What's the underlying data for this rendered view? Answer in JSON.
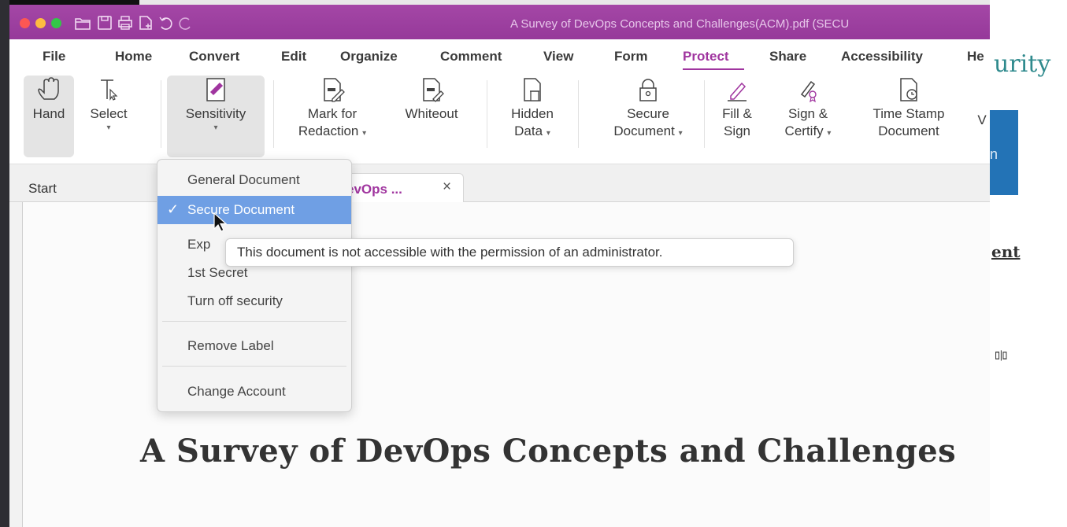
{
  "window": {
    "title": "A Survey of DevOps Concepts and Challenges(ACM).pdf (SECU"
  },
  "menubar": {
    "items": [
      "File",
      "Home",
      "Convert",
      "Edit",
      "Organize",
      "Comment",
      "View",
      "Form",
      "Protect",
      "Share",
      "Accessibility",
      "He"
    ],
    "active": "Protect"
  },
  "ribbon": {
    "hand": "Hand",
    "select": "Select",
    "sensitivity": "Sensitivity",
    "mark_for_redaction_1": "Mark for",
    "mark_for_redaction_2": "Redaction",
    "whiteout": "Whiteout",
    "hidden_data_1": "Hidden",
    "hidden_data_2": "Data",
    "secure_document_1": "Secure",
    "secure_document_2": "Document",
    "fill_sign_1": "Fill &",
    "fill_sign_2": "Sign",
    "sign_certify_1": "Sign &",
    "sign_certify_2": "Certify",
    "time_stamp_1": "Time Stamp",
    "time_stamp_2": "Document",
    "more": "V"
  },
  "tabs": {
    "start": "Start",
    "document": "evOps ...",
    "close": "×"
  },
  "dropdown": {
    "items": [
      "General Document",
      "Secure Document",
      "Exp",
      "1st Secret",
      "Turn off security",
      "Remove Label",
      "Change Account"
    ],
    "selected": "Secure Document",
    "check": "✓"
  },
  "tooltip": {
    "text": "This document is not accessible with the permission of an administrator."
  },
  "document": {
    "title": "A Survey of DevOps Concepts and Challenges"
  },
  "background": {
    "brand_fragment": "urity",
    "blue_fragment": "n",
    "ent_fragment": "ent",
    "side_mark": "믐"
  },
  "colors": {
    "titlebar": "#a447a6",
    "accent": "#a0359f",
    "selection": "#6f9fe4"
  }
}
